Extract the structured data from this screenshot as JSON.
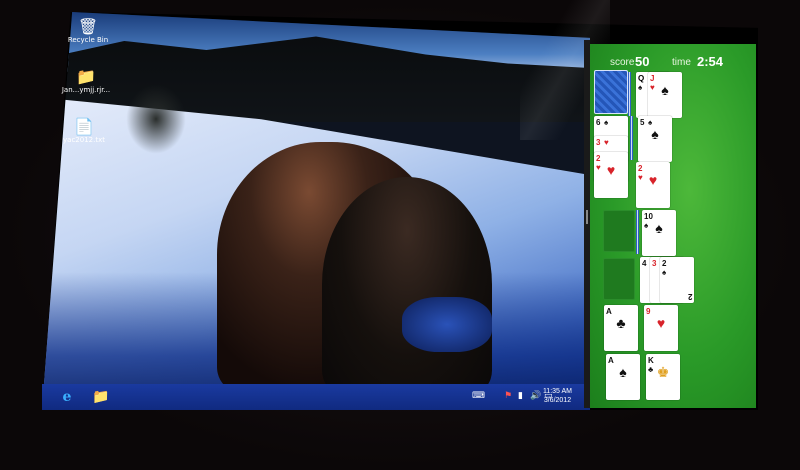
{
  "desktop": {
    "icons": [
      {
        "label": "Recycle Bin",
        "icon": "recycle-bin-icon",
        "glyph": "🗑"
      },
      {
        "label": "Jan...ymjj.rjr...",
        "icon": "folder-icon",
        "glyph": "📁"
      },
      {
        "label": "yac2012.txt",
        "icon": "text-file-icon",
        "glyph": "📄"
      }
    ]
  },
  "taskbar": {
    "pinned": [
      {
        "icon": "internet-explorer-icon",
        "glyph": "e"
      },
      {
        "icon": "file-explorer-icon",
        "glyph": "📁"
      }
    ],
    "tray": [
      {
        "icon": "keyboard-icon",
        "glyph": "⌨"
      },
      {
        "icon": "flag-icon",
        "glyph": "⚑"
      },
      {
        "icon": "network-icon",
        "glyph": "▮"
      },
      {
        "icon": "volume-icon",
        "glyph": "🔊"
      },
      {
        "icon": "action-center-icon",
        "glyph": "▭"
      }
    ],
    "clock": {
      "time": "11:35 AM",
      "date": "3/6/2012"
    }
  },
  "solitaire": {
    "score_label": "score",
    "score_value": "50",
    "time_label": "time",
    "time_value": "2:54",
    "cards": {
      "waste_q": {
        "rank": "Q",
        "suit": "♠",
        "color": "black"
      },
      "waste_j": {
        "rank": "J",
        "suit": "♥",
        "color": "red"
      },
      "t1_6": {
        "rank": "6",
        "suit": "♠",
        "color": "black"
      },
      "t1_3": {
        "rank": "3",
        "suit": "♥",
        "color": "red"
      },
      "t1_2": {
        "rank": "2",
        "suit": "♥",
        "color": "red"
      },
      "t2_5": {
        "rank": "5",
        "suit": "♠",
        "color": "black"
      },
      "t3_2": {
        "rank": "2",
        "suit": "♥",
        "color": "red"
      },
      "t4_10": {
        "rank": "10",
        "suit": "♠",
        "color": "black"
      },
      "t5_4": {
        "rank": "4",
        "suit": "♠",
        "color": "black"
      },
      "t5_3": {
        "rank": "3",
        "suit": "♥",
        "color": "red"
      },
      "t5_2": {
        "rank": "2",
        "suit": "♠",
        "color": "black"
      },
      "t6_a": {
        "rank": "A",
        "suit": "♣",
        "color": "black"
      },
      "t6_9": {
        "rank": "9",
        "suit": "♥",
        "color": "red"
      },
      "t7_a": {
        "rank": "A",
        "suit": "♠",
        "color": "black"
      },
      "t7_k": {
        "rank": "K",
        "suit": "♣",
        "color": "black"
      }
    }
  }
}
